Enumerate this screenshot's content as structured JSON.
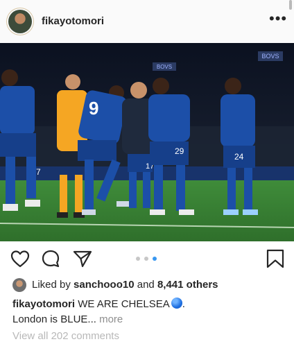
{
  "post": {
    "username": "fikayotomori",
    "more_icon": "more-horizontal-icon"
  },
  "photo": {
    "jersey_numbers": [
      "9",
      "29",
      "7",
      "24",
      "17"
    ],
    "board_texts": [
      "BOVS",
      "BOVS"
    ],
    "kit_color": "#1c4fa8",
    "keeper_color": "#f5a623",
    "pitch_color": "#3f8c3a"
  },
  "actions": {
    "like_icon": "heart-icon",
    "comment_icon": "comment-icon",
    "share_icon": "paper-plane-icon",
    "save_icon": "bookmark-icon",
    "carousel_dots": 3,
    "active_dot": 3
  },
  "likes": {
    "prefix": "Liked by",
    "user": "sanchooo10",
    "and": "and",
    "others": "8,441 others"
  },
  "caption": {
    "username": "fikayotomori",
    "text_line1": "WE ARE CHELSEA",
    "emoji": "blue-circle-emoji",
    "text_line1_end": ".",
    "text_line2": "London is BLUE...",
    "more_link": "more"
  },
  "comments": {
    "view_all": "View all 202 comments"
  }
}
